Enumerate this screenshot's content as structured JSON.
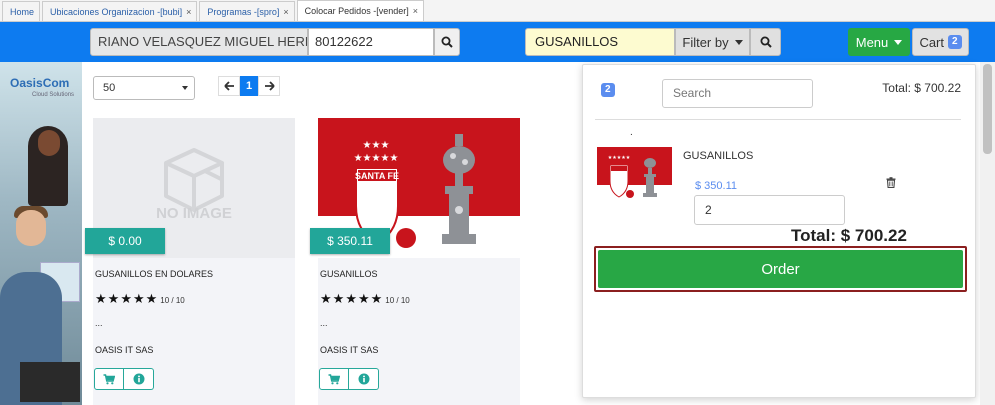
{
  "tabs": [
    {
      "label": "Home",
      "closable": false
    },
    {
      "label": "Ubicaciones Organizacion -[bubi]",
      "closable": true
    },
    {
      "label": "Programas -[spro]",
      "closable": true
    },
    {
      "label": "Colocar Pedidos -[vender]",
      "closable": true,
      "active": true
    }
  ],
  "close_glyph": "×",
  "navbar": {
    "customer_name": "RIANO VELASQUEZ MIGUEL HERNAN",
    "customer_id": "80122622",
    "product_search": "GUSANILLOS",
    "filter_label": "Filter by",
    "menu_label": "Menu",
    "cart_label": "Cart",
    "cart_count": "2"
  },
  "banner": {
    "logo": "OasisCom",
    "sub": "Cloud Solutions"
  },
  "page_size": "50",
  "pager": {
    "current": "1"
  },
  "products": [
    {
      "name": "GUSANILLOS EN DOLARES",
      "price": "$ 0.00",
      "rating": "10 / 10",
      "desc": "...",
      "vendor": "OASIS IT SAS",
      "image": "no-image",
      "no_image_text": "NO IMAGE"
    },
    {
      "name": "GUSANILLOS",
      "price": "$ 350.11",
      "rating": "10 / 10",
      "desc": "...",
      "vendor": "OASIS IT SAS",
      "image": "santa-fe",
      "logo_text": "SANTA FE"
    }
  ],
  "cart": {
    "count": "2",
    "search_placeholder": "Search",
    "total_label": "Total: $ 700.22",
    "dot": ".",
    "item": {
      "name": "GUSANILLOS",
      "price": "$ 350.11",
      "quantity": "2"
    },
    "grand_total": "Total: $ 700.22",
    "order_label": "Order"
  },
  "colors": {
    "nav": "#0d7bf0",
    "green": "#28a745",
    "teal": "#22a699",
    "badge": "#5b8def",
    "order_border": "#8b1f1f"
  }
}
